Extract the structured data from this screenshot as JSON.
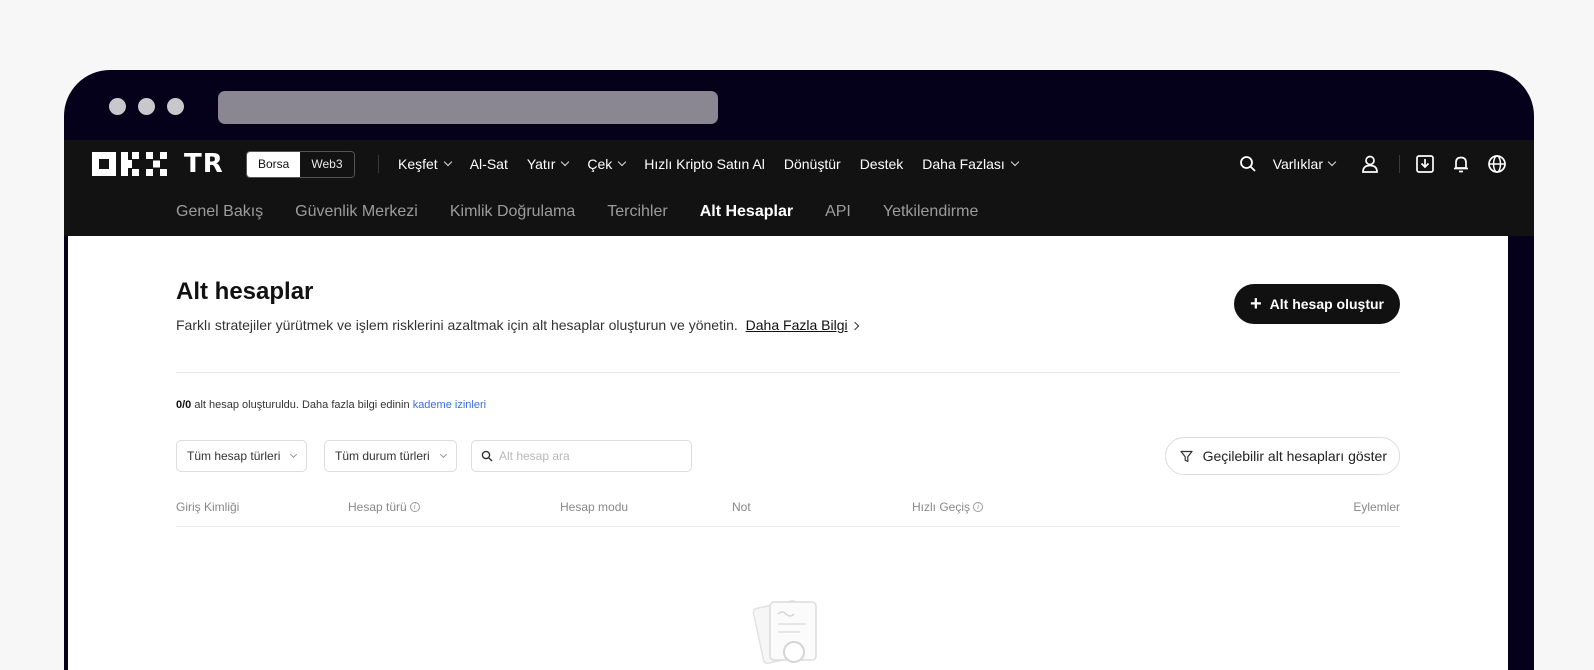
{
  "topnav": {
    "logo_text": "TR",
    "mode_options": [
      "Borsa",
      "Web3"
    ],
    "links": [
      {
        "label": "Keşfet",
        "dropdown": true
      },
      {
        "label": "Al-Sat",
        "dropdown": false
      },
      {
        "label": "Yatır",
        "dropdown": true
      },
      {
        "label": "Çek",
        "dropdown": true
      },
      {
        "label": "Hızlı Kripto Satın Al",
        "dropdown": false
      },
      {
        "label": "Dönüştür",
        "dropdown": false
      },
      {
        "label": "Destek",
        "dropdown": false
      },
      {
        "label": "Daha Fazlası",
        "dropdown": true
      }
    ],
    "assets_label": "Varlıklar"
  },
  "subnav": {
    "items": [
      "Genel Bakış",
      "Güvenlik Merkezi",
      "Kimlik Doğrulama",
      "Tercihler",
      "Alt Hesaplar",
      "API",
      "Yetkilendirme"
    ],
    "active_index": 4
  },
  "main": {
    "title": "Alt hesaplar",
    "description": "Farklı stratejiler yürütmek ve işlem risklerini azaltmak için alt hesaplar oluşturun ve yönetin.",
    "learn_more": "Daha Fazla Bilgi",
    "create_button": "Alt hesap oluştur",
    "count_value": "0/0",
    "count_text": "alt hesap oluşturuldu. Daha fazla bilgi edinin",
    "count_link": "kademe izinleri",
    "filters": {
      "account_type": "Tüm hesap türleri",
      "status_type": "Tüm durum türleri",
      "search_placeholder": "Alt hesap ara"
    },
    "show_button": "Geçilebilir alt hesapları göster",
    "table_headers": [
      "Giriş Kimliği",
      "Hesap türü",
      "Hesap modu",
      "Not",
      "Hızlı Geçiş",
      "Eylemler"
    ]
  },
  "colors": {
    "window_frame": "#05011a",
    "nav_bg": "#121212",
    "link_blue": "#3a6fe0",
    "primary_button": "#111111"
  }
}
